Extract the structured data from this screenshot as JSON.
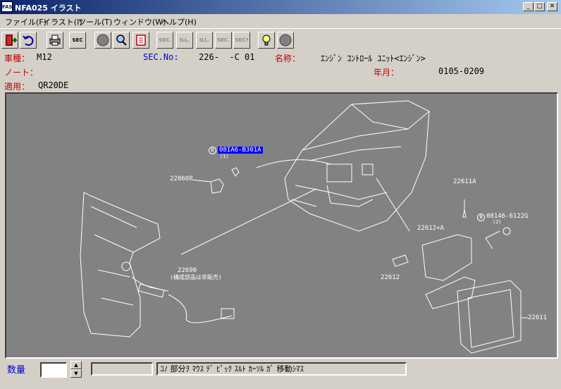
{
  "window": {
    "title": "NFA025 イラスト",
    "icon_label": "FAST",
    "minimize": "_",
    "maximize": "□",
    "close": "✕"
  },
  "menu": [
    "ファイル(F)",
    "イラスト(I)",
    "ツール(T)",
    "ウィンドウ(W)",
    "ヘルプ(H)"
  ],
  "toolbar": {
    "sec_label": "SEC",
    "sec_btn": "SEC.",
    "ill_btn": "ILL.",
    "sec_q": "SEC?"
  },
  "info": {
    "vehicle_label": "車種：",
    "vehicle_value": "M12",
    "sec_no_label": "SEC.No:",
    "sec_no_value": "226-  -C 01",
    "name_label": "名称：",
    "name_value": "ｴﾝｼﾞﾝ ｺﾝﾄﾛｰﾙ ﾕﾆｯﾄ<ｴﾝｼﾞﾝ>",
    "note_label": "ノート：",
    "year_label": "年月：",
    "year_value": "0105-0209",
    "apply_label": "適用：",
    "apply_value": "QR20DE"
  },
  "illustration": {
    "part_highlight": "08IA6-B301A",
    "part_highlight_qty": "(1)",
    "part_22060p": "22060P",
    "part_22611a": "22611A",
    "part_08146": "08146-6122G",
    "part_08146_qty": "(2)",
    "part_22612a": "22612+A",
    "part_22612": "22612",
    "part_22690": "22690",
    "part_22690_note": "(構成部品は非販売)",
    "part_22611": "22611",
    "bolt_symbol": "B"
  },
  "status": {
    "qty_label": "数量",
    "qty_value": "",
    "field_value": "",
    "message": "ｺﾉ 部分ｦ ﾏｳｽ ﾃﾞ ﾋﾟｯｸ ｽﾙﾄ ｶｰｿﾙ ｶﾞ 移動ｼﾏｽ"
  },
  "colors": {
    "canvas_bg": "#828282",
    "highlight": "#0000ff",
    "label_red": "#c00000",
    "label_blue": "#0000cc"
  }
}
